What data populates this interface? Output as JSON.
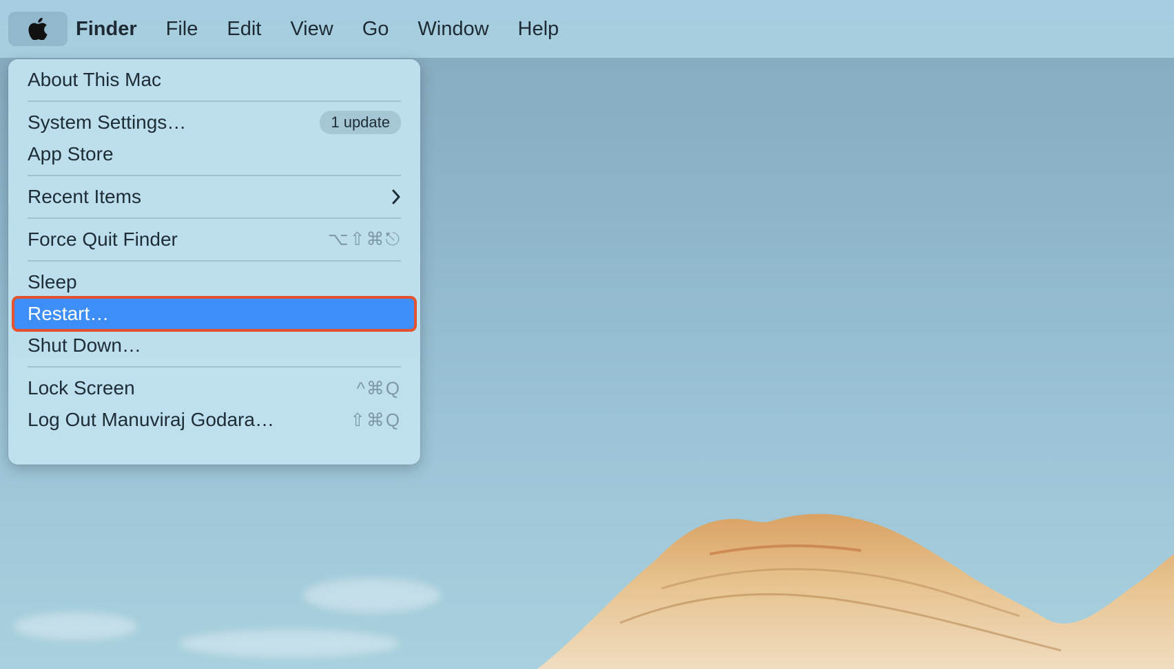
{
  "menubar": {
    "apple_icon": "apple-logo-icon",
    "app_name": "Finder",
    "menus": [
      "File",
      "Edit",
      "View",
      "Go",
      "Window",
      "Help"
    ]
  },
  "apple_menu": {
    "about": "About This Mac",
    "system_settings": "System Settings…",
    "update_badge": "1 update",
    "app_store": "App Store",
    "recent_items": "Recent Items",
    "recent_items_icon": "chevron-right-icon",
    "force_quit": "Force Quit Finder",
    "force_quit_shortcut": "⌥⇧⌘⎋",
    "sleep": "Sleep",
    "restart": "Restart…",
    "shut_down": "Shut Down…",
    "lock_screen": "Lock Screen",
    "lock_screen_shortcut": "^⌘Q",
    "log_out": "Log Out Manuviraj Godara…",
    "log_out_shortcut": "⇧⌘Q"
  },
  "colors": {
    "highlight": "#3d8ef8",
    "highlight_outline": "#e5522f"
  }
}
